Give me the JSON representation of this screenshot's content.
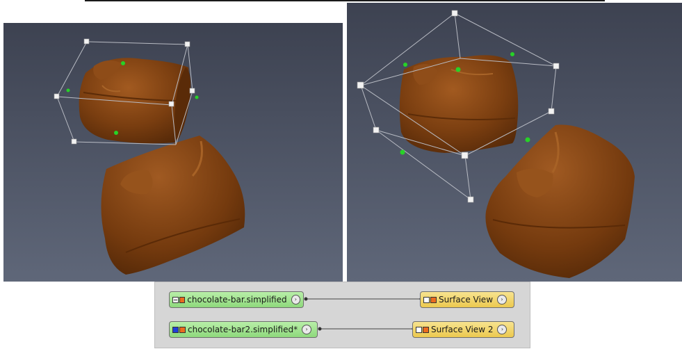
{
  "colors": {
    "viewport_top": "#3c4150",
    "viewport_bottom": "#5c6477",
    "chocolate": "#7a3e10",
    "data_node": "#a6e596",
    "module_node": "#f1d86f",
    "handle_green": "#27d227"
  },
  "pool": {
    "nodes": [
      {
        "label": "chocolate-bar.simplified",
        "kind": "data",
        "icons": [
          "toggle-minus-icon",
          "orange-square-icon"
        ]
      },
      {
        "label": "Surface View",
        "kind": "module",
        "icons": [
          "white-square-icon",
          "orange-square-icon"
        ]
      },
      {
        "label": "chocolate-bar2.simplified*",
        "kind": "data",
        "icons": [
          "blue-square-icon",
          "orange-square-icon"
        ]
      },
      {
        "label": "Surface View 2",
        "kind": "module",
        "icons": [
          "white-square-icon",
          "orange-square-icon"
        ]
      }
    ],
    "arrow_icon": "circle-chevron-right-icon"
  }
}
